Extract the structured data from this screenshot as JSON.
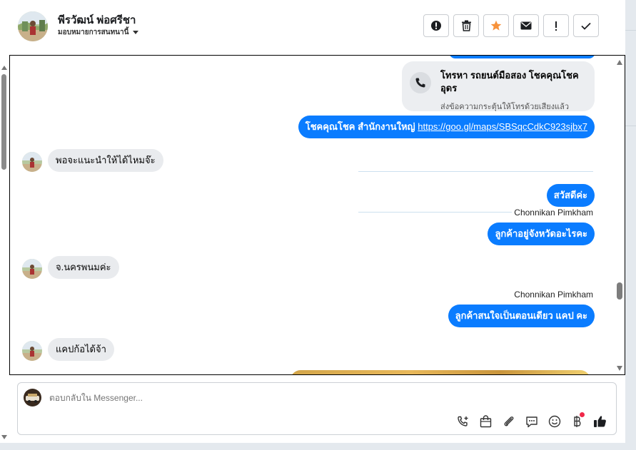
{
  "header": {
    "contact_name": "พีรวัฒน์ พ่อศรีชา",
    "assign_label": "มอบหมายการสนทนานี้",
    "actions": [
      {
        "icon": "alert-circle-icon"
      },
      {
        "icon": "trash-icon"
      },
      {
        "icon": "star-icon",
        "color": "#f7923b"
      },
      {
        "icon": "envelope-icon"
      },
      {
        "icon": "exclamation-icon"
      },
      {
        "icon": "checkmark-icon"
      }
    ]
  },
  "call_card": {
    "title": "โทรหา รถยนต์มือสอง โชคคุณโชค อุดร",
    "subtitle": "ส่งข้อความกระตุ้นให้โทรด้วยเสียงแล้ว",
    "icon": "phone-icon"
  },
  "messages": [
    {
      "direction": "out",
      "text": "โชคคุณโชค สำนักงานใหญ่ ",
      "link": "https://goo.gl/maps/SBSqcCdkC923sjbx7"
    },
    {
      "direction": "in",
      "text": "พอจะแนะนำให้ได้ไหมจ๊ะ"
    },
    {
      "direction": "out",
      "text": "สวัสดีค่ะ"
    },
    {
      "direction": "out",
      "sender": "Chonnikan Pimkham",
      "text": "ลูกค้าอยู่จังหวัดอะไรคะ"
    },
    {
      "direction": "in",
      "text": "จ.นครพนมค่ะ"
    },
    {
      "direction": "out",
      "sender": "Chonnikan Pimkham",
      "text": "ลูกค้าสนใจเป็นตอนเดียว แคป คะ"
    },
    {
      "direction": "in",
      "text": "แคปก้อได้จ้า"
    }
  ],
  "composer": {
    "placeholder": "ตอบกลับใน Messenger...",
    "tools": [
      "phone-plus-icon",
      "shopping-bag-icon",
      "paperclip-icon",
      "chat-bubble-icon",
      "smiley-icon",
      "baht-icon",
      "thumbs-up-icon"
    ]
  },
  "colors": {
    "outgoing_bubble": "#0a7cff",
    "incoming_bubble": "#e9ebee",
    "star": "#f7923b",
    "notification_dot": "#f02849"
  }
}
